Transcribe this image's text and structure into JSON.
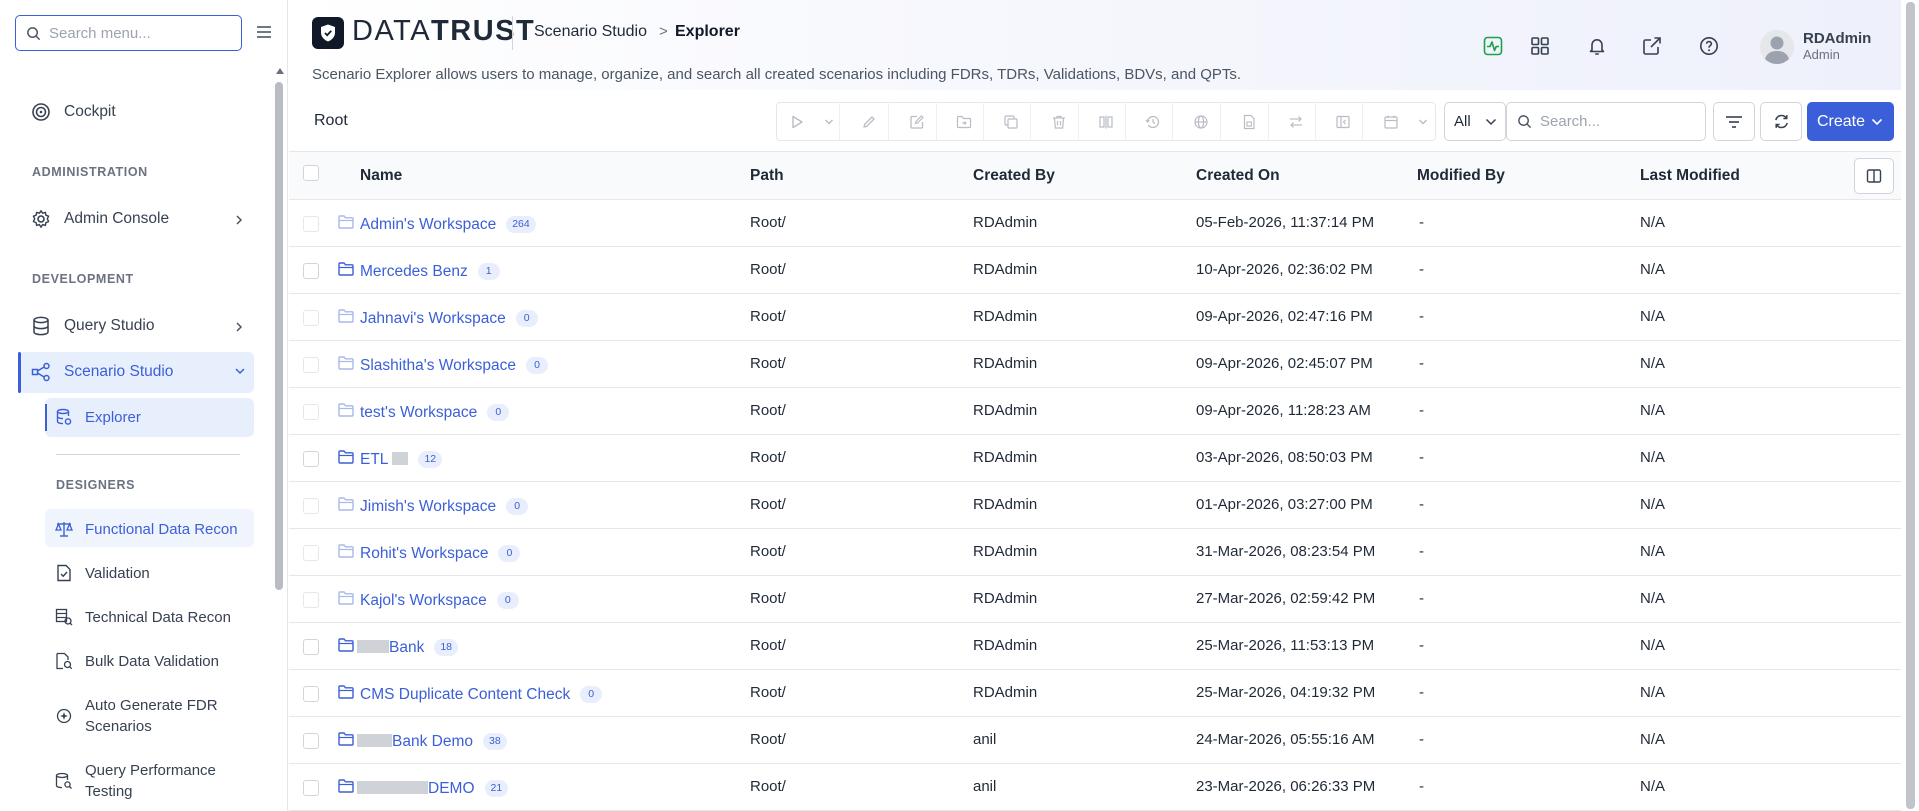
{
  "sidebar": {
    "search_placeholder": "Search menu...",
    "items": {
      "cockpit": "Cockpit",
      "admin_section": "ADMINISTRATION",
      "admin_console": "Admin Console",
      "dev_section": "DEVELOPMENT",
      "query_studio": "Query Studio",
      "scenario_studio": "Scenario Studio",
      "explorer": "Explorer",
      "designers_section": "DESIGNERS",
      "functional_data_recon": "Functional Data Recon",
      "validation": "Validation",
      "technical_data_recon": "Technical Data Recon",
      "bulk_data_validation": "Bulk Data Validation",
      "auto_generate_fdr_1": "Auto Generate FDR",
      "auto_generate_fdr_2": "Scenarios",
      "query_perf_1": "Query Performance",
      "query_perf_2": "Testing"
    }
  },
  "header": {
    "logo_part1": "DATA",
    "logo_part2": "TRUST",
    "breadcrumb_parent": "Scenario Studio",
    "breadcrumb_sep": ">",
    "breadcrumb_current": "Explorer",
    "description": "Scenario Explorer allows users to manage, organize, and search all created scenarios including FDRs, TDRs, Validations, BDVs, and QPTs.",
    "user_name": "RDAdmin",
    "user_role": "Admin"
  },
  "toolbar": {
    "root_label": "Root",
    "filter_value": "All",
    "search_placeholder": "Search...",
    "create_label": "Create"
  },
  "table": {
    "headers": {
      "name": "Name",
      "path": "Path",
      "created_by": "Created By",
      "created_on": "Created On",
      "modified_by": "Modified By",
      "last_modified": "Last Modified"
    },
    "rows": [
      {
        "name": "Admin's Workspace",
        "count": "264",
        "path": "Root/",
        "created_by": "RDAdmin",
        "created_on": "05-Feb-2026, 11:37:14 PM",
        "modified_by": "-",
        "last_modified": "N/A"
      },
      {
        "name": "Mercedes Benz",
        "count": "1",
        "path": "Root/",
        "created_by": "RDAdmin",
        "created_on": "10-Apr-2026, 02:36:02 PM",
        "modified_by": "-",
        "last_modified": "N/A"
      },
      {
        "name": "Jahnavi's Workspace",
        "count": "0",
        "path": "Root/",
        "created_by": "RDAdmin",
        "created_on": "09-Apr-2026, 02:47:16 PM",
        "modified_by": "-",
        "last_modified": "N/A"
      },
      {
        "name": "Slashitha's Workspace",
        "count": "0",
        "path": "Root/",
        "created_by": "RDAdmin",
        "created_on": "09-Apr-2026, 02:45:07 PM",
        "modified_by": "-",
        "last_modified": "N/A"
      },
      {
        "name": "test's Workspace",
        "count": "0",
        "path": "Root/",
        "created_by": "RDAdmin",
        "created_on": "09-Apr-2026, 11:28:23 AM",
        "modified_by": "-",
        "last_modified": "N/A"
      },
      {
        "name": "ETL",
        "count": "12",
        "path": "Root/",
        "created_by": "RDAdmin",
        "created_on": "03-Apr-2026, 08:50:03 PM",
        "modified_by": "-",
        "last_modified": "N/A"
      },
      {
        "name": "Jimish's Workspace",
        "count": "0",
        "path": "Root/",
        "created_by": "RDAdmin",
        "created_on": "01-Apr-2026, 03:27:00 PM",
        "modified_by": "-",
        "last_modified": "N/A"
      },
      {
        "name": "Rohit's Workspace",
        "count": "0",
        "path": "Root/",
        "created_by": "RDAdmin",
        "created_on": "31-Mar-2026, 08:23:54 PM",
        "modified_by": "-",
        "last_modified": "N/A"
      },
      {
        "name": "Kajol's Workspace",
        "count": "0",
        "path": "Root/",
        "created_by": "RDAdmin",
        "created_on": "27-Mar-2026, 02:59:42 PM",
        "modified_by": "-",
        "last_modified": "N/A"
      },
      {
        "name": "Bank",
        "count": "18",
        "path": "Root/",
        "created_by": "RDAdmin",
        "created_on": "25-Mar-2026, 11:53:13 PM",
        "modified_by": "-",
        "last_modified": "N/A"
      },
      {
        "name": "CMS Duplicate Content Check",
        "count": "0",
        "path": "Root/",
        "created_by": "RDAdmin",
        "created_on": "25-Mar-2026, 04:19:32 PM",
        "modified_by": "-",
        "last_modified": "N/A"
      },
      {
        "name": "Bank Demo",
        "count": "38",
        "path": "Root/",
        "created_by": "anil",
        "created_on": "24-Mar-2026, 05:55:16 AM",
        "modified_by": "-",
        "last_modified": "N/A"
      },
      {
        "name": "DEMO",
        "count": "21",
        "path": "Root/",
        "created_by": "anil",
        "created_on": "23-Mar-2026, 06:26:33 PM",
        "modified_by": "-",
        "last_modified": "N/A"
      }
    ]
  },
  "colors": {
    "accent": "#3b5fd9",
    "active_bg": "#e8effc",
    "badge_bg": "#e8eefc",
    "status_green": "#16a34a"
  }
}
